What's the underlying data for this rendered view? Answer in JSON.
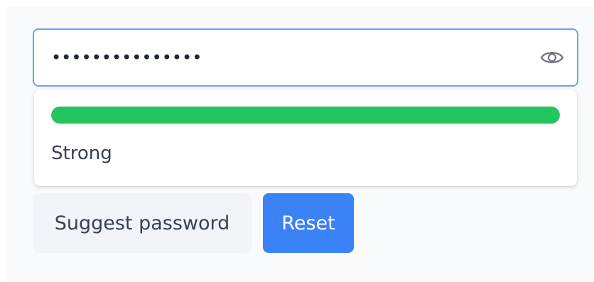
{
  "password_field": {
    "masked_value": "•••••••••••••••",
    "toggle_icon": "eye-icon"
  },
  "strength": {
    "label": "Strong",
    "level": 1.0,
    "color": "#22c55e"
  },
  "actions": {
    "suggest_label": "Suggest password",
    "reset_label": "Reset"
  },
  "colors": {
    "accent": "#3b82f6",
    "field_border": "#6ea0f5",
    "secondary_button": "#f1f5f9"
  }
}
